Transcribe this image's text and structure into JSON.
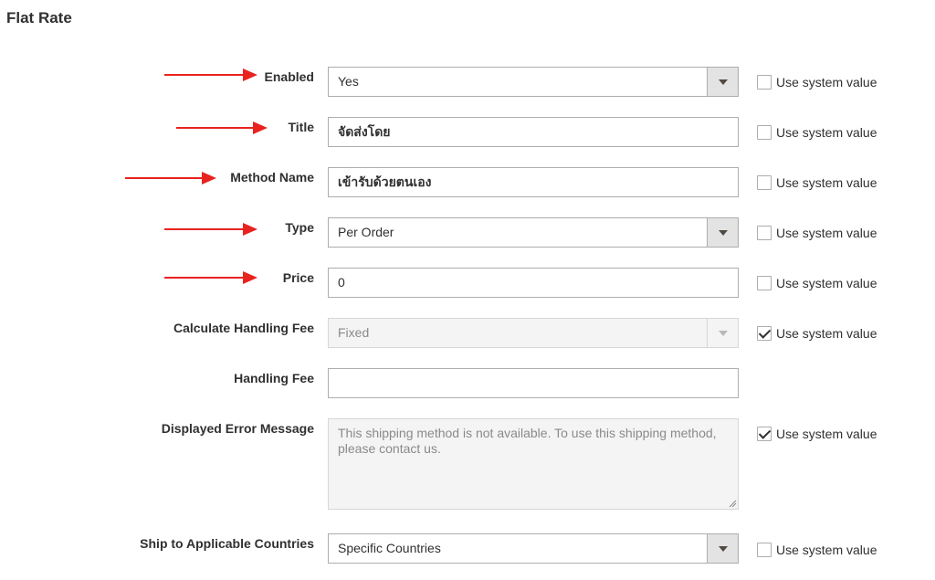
{
  "section": {
    "title": "Flat Rate"
  },
  "system_value_label": "Use system value",
  "fields": {
    "enabled": {
      "label": "Enabled",
      "value": "Yes",
      "use_system": false
    },
    "title": {
      "label": "Title",
      "value": "จัดส่งโดย",
      "use_system": false
    },
    "method_name": {
      "label": "Method Name",
      "value": "เข้ารับด้วยตนเอง",
      "use_system": false
    },
    "type": {
      "label": "Type",
      "value": "Per Order",
      "use_system": false
    },
    "price": {
      "label": "Price",
      "value": "0",
      "use_system": false
    },
    "calculate_handling_fee": {
      "label": "Calculate Handling Fee",
      "value": "Fixed",
      "use_system": true
    },
    "handling_fee": {
      "label": "Handling Fee",
      "value": ""
    },
    "displayed_error_message": {
      "label": "Displayed Error Message",
      "value": "This shipping method is not available. To use this shipping method, please contact us.",
      "use_system": true
    },
    "ship_to_applicable_countries": {
      "label": "Ship to Applicable Countries",
      "value": "Specific Countries",
      "use_system": false
    }
  },
  "annotation_color": "#e8231f"
}
